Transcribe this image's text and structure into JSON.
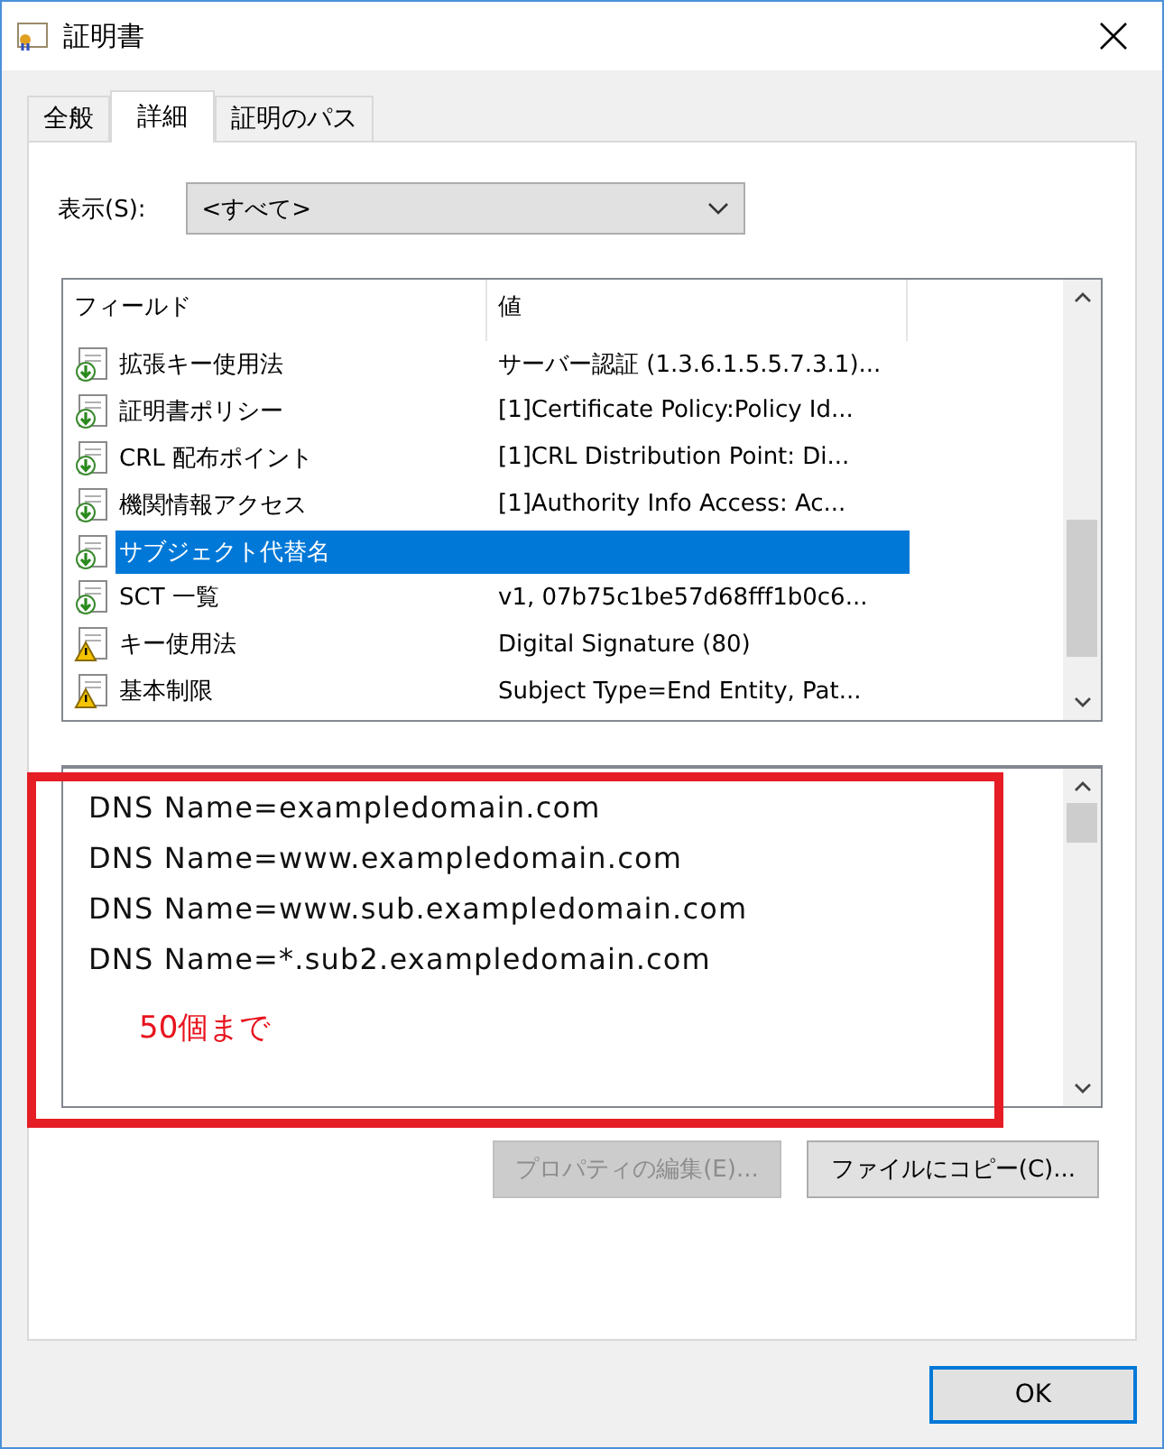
{
  "window": {
    "title": "証明書"
  },
  "tabs": [
    {
      "label": "全般",
      "selected": false
    },
    {
      "label": "詳細",
      "selected": true
    },
    {
      "label": "証明のパス",
      "selected": false
    }
  ],
  "show": {
    "label": "表示(S):",
    "value": "<すべて>"
  },
  "table": {
    "columns": [
      "フィールド",
      "値"
    ],
    "rows": [
      {
        "kind": "extension",
        "field": "拡張キー使用法",
        "value": "サーバー認証 (1.3.6.1.5.5.7.3.1)...",
        "selected": false
      },
      {
        "kind": "extension",
        "field": "証明書ポリシー",
        "value": "[1]Certificate Policy:Policy Id...",
        "selected": false
      },
      {
        "kind": "extension",
        "field": "CRL 配布ポイント",
        "value": "[1]CRL Distribution Point: Di...",
        "selected": false
      },
      {
        "kind": "extension",
        "field": "機関情報アクセス",
        "value": "[1]Authority Info Access: Ac...",
        "selected": false
      },
      {
        "kind": "extension",
        "field": "サブジェクト代替名",
        "value": "",
        "selected": true
      },
      {
        "kind": "extension",
        "field": "SCT 一覧",
        "value": "v1, 07b75c1be57d68fff1b0c6...",
        "selected": false
      },
      {
        "kind": "critical",
        "field": "キー使用法",
        "value": "Digital Signature (80)",
        "selected": false
      },
      {
        "kind": "critical",
        "field": "基本制限",
        "value": "Subject Type=End Entity, Pat...",
        "selected": false
      }
    ]
  },
  "details": [
    "DNS Name=exampledomain.com",
    "DNS Name=www.exampledomain.com",
    "DNS Name=www.sub.exampledomain.com",
    "DNS Name=*.sub2.exampledomain.com"
  ],
  "annotation": {
    "note": "50個まで"
  },
  "buttons": [
    {
      "label": "プロパティの編集(E)...",
      "disabled": true
    },
    {
      "label": "ファイルにコピー(C)...",
      "disabled": false
    }
  ],
  "footer": {
    "ok": "OK"
  }
}
